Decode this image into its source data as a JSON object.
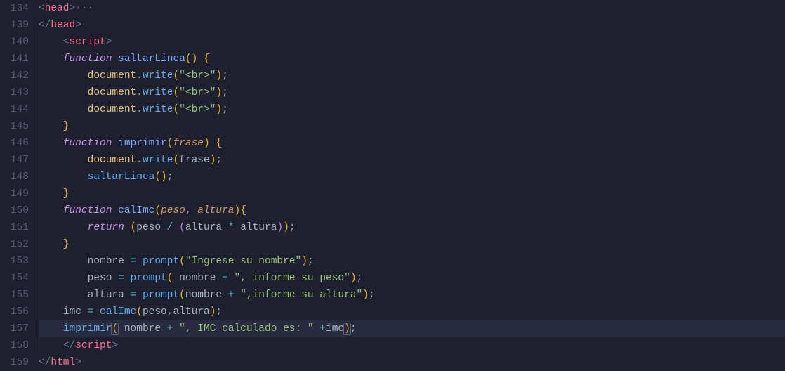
{
  "gutter": {
    "lines": [
      "134",
      "139",
      "140",
      "141",
      "142",
      "143",
      "144",
      "145",
      "146",
      "147",
      "148",
      "149",
      "150",
      "151",
      "152",
      "153",
      "154",
      "155",
      "156",
      "157",
      "158",
      "159"
    ]
  },
  "fold_symbol": "›",
  "code": {
    "l134": {
      "head_open": "<",
      "head": "head",
      "head_close": ">",
      "dots": "···"
    },
    "l139": {
      "head_open": "</",
      "head": "head",
      "head_close": ">"
    },
    "l140": {
      "script_open": "<",
      "script": "script",
      "script_close": ">"
    },
    "l141": {
      "kw": "function",
      "name": "saltarLinea",
      "p1": "(",
      "p2": ")",
      "sp": " ",
      "brace": "{"
    },
    "l142": {
      "obj": "document",
      "dot": ".",
      "method": "write",
      "p1": "(",
      "str": "\"<br>\"",
      "p2": ")",
      "semi": ";"
    },
    "l143": {
      "obj": "document",
      "dot": ".",
      "method": "write",
      "p1": "(",
      "str": "\"<br>\"",
      "p2": ")",
      "semi": ";"
    },
    "l144": {
      "obj": "document",
      "dot": ".",
      "method": "write",
      "p1": "(",
      "str": "\"<br>\"",
      "p2": ")",
      "semi": ";"
    },
    "l145": {
      "brace": "}"
    },
    "l146": {
      "kw": "function",
      "name": "imprimir",
      "p1": "(",
      "param": "frase",
      "p2": ")",
      "sp": " ",
      "brace": "{"
    },
    "l147": {
      "obj": "document",
      "dot": ".",
      "method": "write",
      "p1": "(",
      "arg": "frase",
      "p2": ")",
      "semi": ";"
    },
    "l148": {
      "call": "saltarLinea",
      "p1": "(",
      "p2": ")",
      "semi": ";"
    },
    "l149": {
      "brace": "}"
    },
    "l150": {
      "kw": "function",
      "name": "calImc",
      "p1": "(",
      "param1": "peso",
      "comma": ", ",
      "param2": "altura",
      "p2": ")",
      "brace": "{"
    },
    "l151": {
      "ret": "return",
      "sp": " ",
      "p1": "(",
      "v1": "peso",
      "op1": " / ",
      "p2": "(",
      "v2": "altura",
      "op2": " * ",
      "v3": "altura",
      "p3": ")",
      "p4": ")",
      "semi": ";"
    },
    "l152": {
      "brace": "}"
    },
    "l153": {
      "var": "nombre",
      "eq": " = ",
      "fn": "prompt",
      "p1": "(",
      "str": "\"Ingrese su nombre\"",
      "p2": ")",
      "semi": ";"
    },
    "l154": {
      "var": "peso",
      "eq": " = ",
      "fn": "prompt",
      "p1": "( ",
      "arg": "nombre",
      "op": " + ",
      "str": "\", informe su peso\"",
      "p2": ")",
      "semi": ";"
    },
    "l155": {
      "var": "altura",
      "eq": " = ",
      "fn": "prompt",
      "p1": "(",
      "arg": "nombre",
      "op": " + ",
      "str": "\",informe su altura\"",
      "p2": ")",
      "semi": ";"
    },
    "l156": {
      "var": "imc",
      "eq": " = ",
      "fn": "calImc",
      "p1": "(",
      "a1": "peso",
      "comma": ",",
      "a2": "altura",
      "p2": ")",
      "semi": ";"
    },
    "l157": {
      "fn": "imprimir",
      "p1": "(",
      "sp": " ",
      "a1": "nombre",
      "op1": " + ",
      "str": "\", IMC calculado es: \"",
      "op2": " +",
      "a2": "imc",
      "p2": ")",
      "semi": ";"
    },
    "l158": {
      "script_open": "</",
      "script": "script",
      "script_close": ">"
    },
    "l159": {
      "html_open": "</",
      "html": "html",
      "html_close": ">"
    }
  }
}
